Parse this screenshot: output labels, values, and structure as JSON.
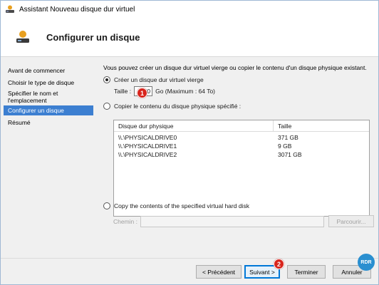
{
  "window": {
    "title": "Assistant Nouveau disque dur virtuel"
  },
  "header": {
    "title": "Configurer un disque"
  },
  "nav": {
    "items": [
      {
        "label": "Avant de commencer"
      },
      {
        "label": "Choisir le type de disque"
      },
      {
        "label": "Spécifier le nom et l'emplacement"
      },
      {
        "label": "Configurer un disque"
      },
      {
        "label": "Résumé"
      }
    ],
    "active_index": 3
  },
  "content": {
    "description": "Vous pouvez créer un disque dur virtuel vierge ou copier le contenu d'un disque physique existant.",
    "option_blank": {
      "label": "Créer un disque dur virtuel vierge",
      "selected": true
    },
    "size": {
      "label": "Taille :",
      "value": "30",
      "unit": "Go (Maximum : 64 To)"
    },
    "option_physical": {
      "label": "Copier le contenu du disque physique spécifié :",
      "selected": false
    },
    "disk_table": {
      "columns": [
        "Disque dur physique",
        "Taille"
      ],
      "rows": [
        [
          "\\\\.\\PHYSICALDRIVE0",
          "371 GB"
        ],
        [
          "\\\\.\\PHYSICALDRIVE1",
          "9 GB"
        ],
        [
          "\\\\.\\PHYSICALDRIVE2",
          "3071 GB"
        ]
      ]
    },
    "option_virtual": {
      "label": "Copy the contents of the specified virtual hard disk",
      "selected": false
    },
    "path": {
      "label": "Chemin :",
      "value": "",
      "browse_label": "Parcourir..."
    }
  },
  "footer": {
    "prev_label": "< Précédent",
    "next_label": "Suivant >",
    "finish_label": "Terminer",
    "cancel_label": "Annuler"
  },
  "annotations": {
    "badge_1": "1",
    "badge_2": "2"
  },
  "watermark": {
    "text": "RDR"
  },
  "colors": {
    "accent": "#3c7fd1",
    "badge": "#d8241c",
    "primary_border": "#0078d7"
  }
}
